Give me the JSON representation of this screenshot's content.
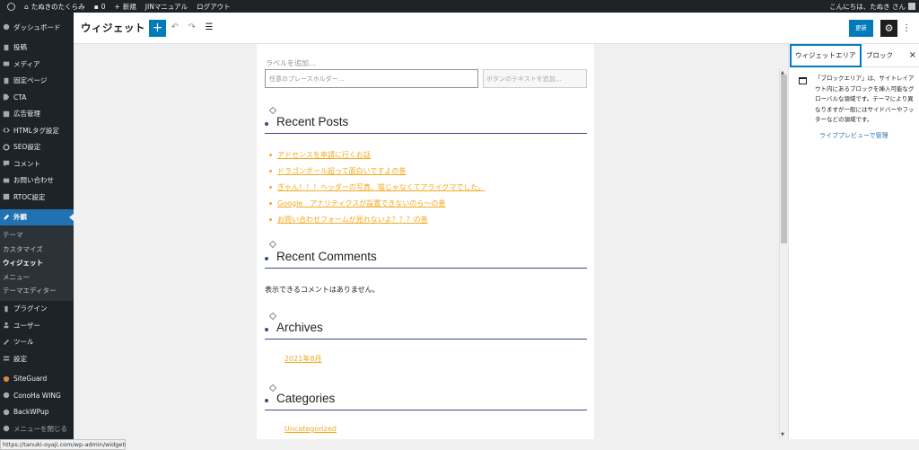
{
  "admin_bar": {
    "site_name": "たぬきのたくらみ",
    "comments_count": "0",
    "new_label": "新規",
    "jin_manual": "JINマニュアル",
    "logout": "ログアウト",
    "greeting": "こんにちは、たぬき さん"
  },
  "sidebar": {
    "items": [
      {
        "label": "ダッシュボード",
        "icon": "dashboard-icon"
      },
      {
        "label": "投稿",
        "icon": "pin-icon"
      },
      {
        "label": "メディア",
        "icon": "media-icon"
      },
      {
        "label": "固定ページ",
        "icon": "page-icon"
      },
      {
        "label": "CTA",
        "icon": "tag-icon"
      },
      {
        "label": "広告管理",
        "icon": "ad-icon"
      },
      {
        "label": "HTMLタグ設定",
        "icon": "code-icon"
      },
      {
        "label": "SEO設定",
        "icon": "gear-icon"
      },
      {
        "label": "コメント",
        "icon": "comment-icon"
      },
      {
        "label": "お問い合わせ",
        "icon": "mail-icon"
      },
      {
        "label": "RTOC設定",
        "icon": "list-icon"
      }
    ],
    "active_item": {
      "label": "外観",
      "icon": "brush-icon"
    },
    "submenu": [
      "テーマ",
      "カスタマイズ",
      "ウィジェット",
      "メニュー",
      "テーマエディター"
    ],
    "lower_items": [
      {
        "label": "プラグイン",
        "icon": "plugin-icon"
      },
      {
        "label": "ユーザー",
        "icon": "user-icon"
      },
      {
        "label": "ツール",
        "icon": "wrench-icon"
      },
      {
        "label": "設定",
        "icon": "settings-icon"
      },
      {
        "label": "SiteGuard",
        "icon": "shield-icon"
      },
      {
        "label": "ConoHa WING",
        "icon": "conoha-icon"
      },
      {
        "label": "BackWPup",
        "icon": "backup-icon"
      },
      {
        "label": "メニューを閉じる",
        "icon": "collapse-icon"
      }
    ]
  },
  "header": {
    "title": "ウィジェット",
    "add_symbol": "+",
    "update_label": "更新"
  },
  "widgets": {
    "search_label_placeholder": "ラベルを追加…",
    "search_input_placeholder": "任意のプレースホルダー…",
    "search_button_placeholder": "ボタンのテキストを追加…",
    "recent_posts_title": "Recent Posts",
    "recent_posts": [
      "アドセンスを申請に行くお話",
      "ドラゴンボール超って面白いですよの巻",
      "ぎゃん！！！ヘッダーの写真、猫じゃなくてアライグマでした。",
      "Google　アナリティクスが設置できないのら～の巻",
      "お問い合わせフォームが見れないよ？？？の巻"
    ],
    "recent_comments_title": "Recent Comments",
    "no_comments": "表示できるコメントはありません。",
    "archives_title": "Archives",
    "archive_item": "2021年8月",
    "categories_title": "Categories",
    "category_item": "Uncategorized"
  },
  "inspector": {
    "tab_widget_area": "ウィジェットエリア",
    "tab_block": "ブロック",
    "close_symbol": "×",
    "description": "「ブロックエリア」は、サイトレイアウト内にあるブロックを挿入可能なグローバルな領域です。テーマにより異なりますが一般にはサイドバーやフッターなどの領域です。",
    "live_preview_link": "ライブプレビューで管理"
  },
  "status_bar": {
    "url": "https://tanuki-oyaji.com/wp-admin/widgets.php"
  },
  "colors": {
    "admin_dark": "#1d2327",
    "accent": "#007cba",
    "link_orange": "#f4a91d",
    "heading_underline": "#3a4a8a"
  }
}
